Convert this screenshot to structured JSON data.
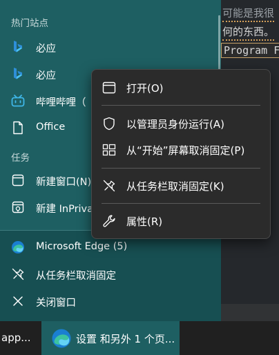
{
  "background_editor": {
    "line1": "可能是我很",
    "line2": "何的东西。",
    "line3": "Program F"
  },
  "jumplist": {
    "frequent_header": "热门站点",
    "frequent_items": [
      {
        "label": "必应",
        "icon": "bing-icon"
      },
      {
        "label": "必应",
        "icon": "bing-icon"
      },
      {
        "label": "哔哩哔哩（",
        "icon": "bilibili-icon"
      },
      {
        "label": "Office",
        "icon": "document-icon"
      }
    ],
    "tasks_header": "任务",
    "task_items": [
      {
        "label": "新建窗口(N)",
        "icon": "window-icon"
      },
      {
        "label": "新建 InPrivat",
        "icon": "inprivate-window-icon"
      }
    ],
    "app_item": {
      "label": "Microsoft Edge (5)",
      "icon": "edge-icon"
    },
    "unpin_item": {
      "label": "从任务栏取消固定",
      "icon": "unpin-icon"
    },
    "close_item": {
      "label": "关闭窗口",
      "icon": "close-icon"
    }
  },
  "context_menu": {
    "items": [
      {
        "label": "打开(O)",
        "icon": "window-icon"
      },
      {
        "label": "以管理员身份运行(A)",
        "icon": "shield-icon"
      },
      {
        "label": "从“开始”屏幕取消固定(P)",
        "icon": "unpin-start-icon"
      },
      {
        "label": "从任务栏取消固定(K)",
        "icon": "unpin-icon"
      },
      {
        "label": "属性(R)",
        "icon": "wrench-icon"
      }
    ]
  },
  "taskbar": {
    "left_label": "app...",
    "active_label": "设置 和另外 1 个页..."
  },
  "colors": {
    "jumplist_bg": "#1e5f62",
    "menu_bg": "#2b2b2b",
    "taskbar_bg": "#202020"
  }
}
